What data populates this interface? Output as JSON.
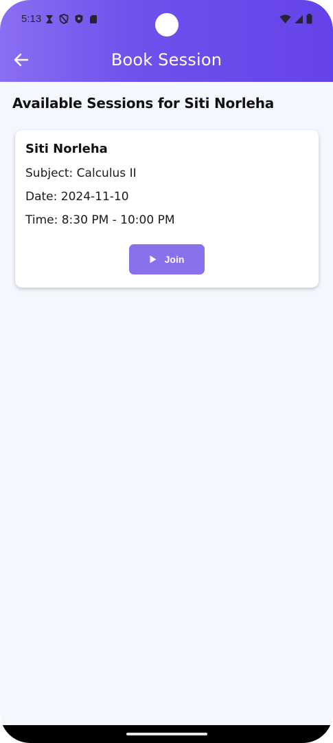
{
  "status_bar": {
    "time": "5:13",
    "left_icons": [
      "hourglass-icon",
      "shield-slash-icon",
      "shield-icon",
      "sd-card-icon"
    ],
    "right_icons": [
      "wifi-icon",
      "signal-icon",
      "battery-icon"
    ]
  },
  "app_bar": {
    "title": "Book Session",
    "back_icon": "arrow-left-icon"
  },
  "page": {
    "heading": "Available Sessions for Siti Norleha"
  },
  "sessions": [
    {
      "tutor_name": "Siti Norleha",
      "subject": "Subject: Calculus II",
      "date": "Date: 2024-11-10",
      "time": "Time: 8:30 PM - 10:00 PM",
      "action_label": "Join",
      "action_icon": "play-icon"
    }
  ],
  "colors": {
    "header_gradient_start": "#8a6ef2",
    "header_gradient_end": "#6543ea",
    "background": "#f4f7fd",
    "button": "#8a71ec",
    "card": "#ffffff"
  }
}
